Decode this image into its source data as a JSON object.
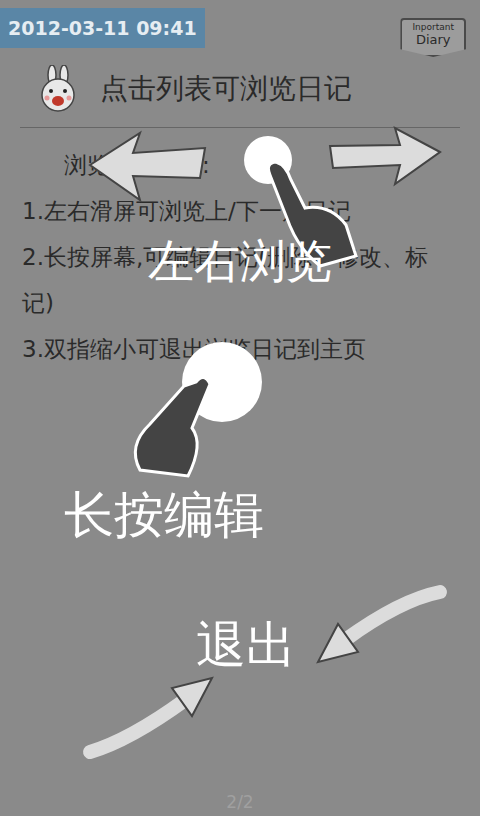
{
  "header": {
    "date": "2012-03-11 09:41",
    "tag": [
      "Inportant",
      "Diary"
    ]
  },
  "title": "点击列表可浏览日记",
  "body": {
    "heading": "浏览日记功能:",
    "items": [
      "1.左右滑屏可浏览上/下一篇日记",
      "2.长按屏幕,可编辑日记(删除、修改、标记)",
      "3.双指缩小可退出浏览日记到主页"
    ]
  },
  "page": "2/2",
  "guides": [
    {
      "kind": "swipe",
      "label": "左右浏览"
    },
    {
      "kind": "press",
      "label": "长按编辑"
    },
    {
      "kind": "pinch",
      "label": "退出"
    }
  ]
}
